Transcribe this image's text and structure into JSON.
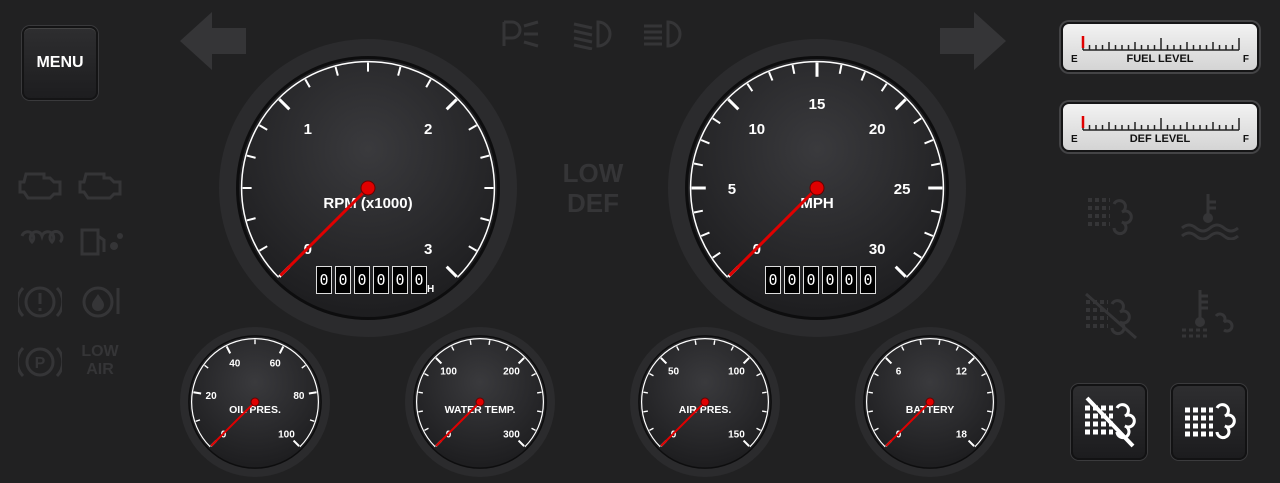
{
  "menu": {
    "label": "MENU"
  },
  "indicators": {
    "low_def": "LOW\nDEF",
    "low_air": "LOW\nAIR"
  },
  "fuel_level": {
    "label": "FUEL LEVEL",
    "empty": "E",
    "full": "F",
    "level": 0.0
  },
  "def_level": {
    "label": "DEF LEVEL",
    "empty": "E",
    "full": "F",
    "level": 0.0
  },
  "tachometer": {
    "label": "RPM (x1000)",
    "ticks": [
      "0",
      "1",
      "2",
      "3"
    ],
    "value": 0,
    "hours_unit": "H",
    "odometer": [
      "0",
      "0",
      "0",
      "0",
      "0",
      "0"
    ]
  },
  "speedometer": {
    "label": "MPH",
    "ticks": [
      "0",
      "5",
      "10",
      "15",
      "20",
      "25",
      "30"
    ],
    "value": 0,
    "odometer": [
      "0",
      "0",
      "0",
      "0",
      "0",
      "0"
    ]
  },
  "oil_pressure": {
    "label": "OIL PRES.",
    "ticks": [
      "0",
      "20",
      "40",
      "60",
      "80",
      "100"
    ],
    "value": 0
  },
  "water_temp": {
    "label": "WATER TEMP.",
    "ticks": [
      "0",
      "100",
      "200",
      "300"
    ],
    "value": 0
  },
  "air_pressure": {
    "label": "AIR PRES.",
    "ticks": [
      "0",
      "50",
      "100",
      "150"
    ],
    "value": 0
  },
  "battery": {
    "label": "BATTERY",
    "ticks": [
      "0",
      "6",
      "12",
      "18"
    ],
    "value": 0
  },
  "colors": {
    "needle": "#e00000",
    "indicator_off": "#353537",
    "gauge_face": "#2a2a2c"
  }
}
